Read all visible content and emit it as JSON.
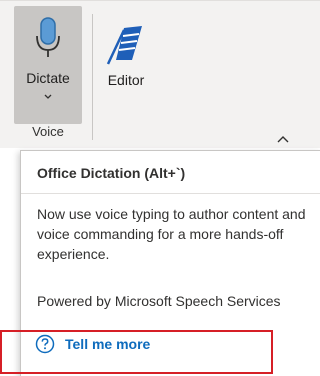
{
  "ribbon": {
    "dictate_label": "Dictate",
    "editor_label": "Editor",
    "group_label": "Voice",
    "icons": [
      "microphone-icon",
      "editor-pen-icon",
      "chevron-down-icon",
      "chevron-up-icon"
    ]
  },
  "tooltip": {
    "title": "Office Dictation (Alt+`)",
    "body": "Now use voice typing to author content and voice commanding for a more hands-off experience.",
    "powered_by": "Powered by Microsoft Speech Services",
    "link_label": "Tell me more",
    "link_icon": "help-circle-icon"
  },
  "colors": {
    "accent": "#0f6cbd",
    "highlight": "#d61f26",
    "ribbon_bg": "#f3f2f1"
  }
}
